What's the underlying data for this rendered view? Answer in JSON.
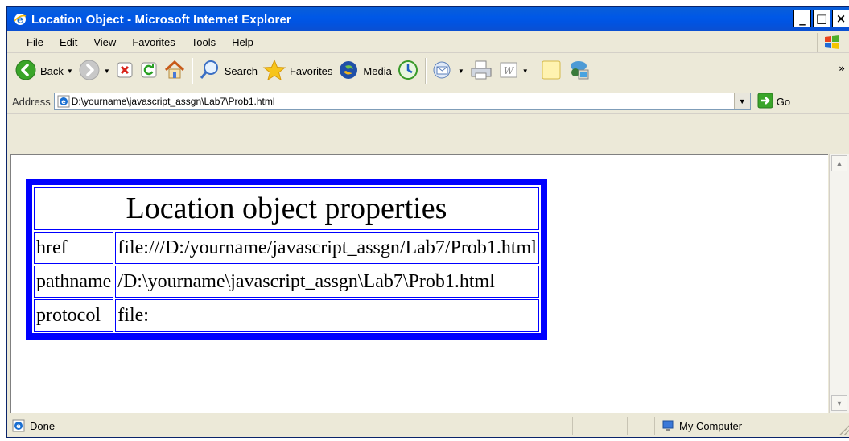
{
  "window": {
    "title": "Location Object - Microsoft Internet Explorer"
  },
  "window_buttons": {
    "minimize": "_",
    "maximize": "□",
    "close": "×"
  },
  "menu": [
    "File",
    "Edit",
    "View",
    "Favorites",
    "Tools",
    "Help"
  ],
  "toolbar": {
    "back_label": "Back",
    "search_label": "Search",
    "favorites_label": "Favorites",
    "media_label": "Media",
    "overflow": "»"
  },
  "address": {
    "label": "Address",
    "value": "D:\\yourname\\javascript_assgn\\Lab7\\Prob1.html",
    "go_label": "Go"
  },
  "page": {
    "caption": "Location object properties",
    "rows": [
      {
        "name": "href",
        "value": "file:///D:/yourname/javascript_assgn/Lab7/Prob1.html"
      },
      {
        "name": "pathname",
        "value": "/D:\\yourname\\javascript_assgn\\Lab7\\Prob1.html"
      },
      {
        "name": "protocol",
        "value": "file:"
      }
    ],
    "table_border_color": "#0000ff"
  },
  "status": {
    "text": "Done",
    "zone": "My Computer"
  },
  "colors": {
    "titlebar": "#0054e3",
    "chrome": "#ece9d8",
    "table_border": "#0000ff"
  },
  "icons": [
    "ie-icon",
    "back-icon",
    "forward-icon",
    "stop-icon",
    "refresh-icon",
    "home-icon",
    "search-icon",
    "favorites-star-icon",
    "media-icon",
    "history-icon",
    "mail-icon",
    "print-icon",
    "word-icon",
    "folder-icon",
    "messenger-icon",
    "windows-logo-icon",
    "go-arrow-icon",
    "my-computer-icon"
  ]
}
